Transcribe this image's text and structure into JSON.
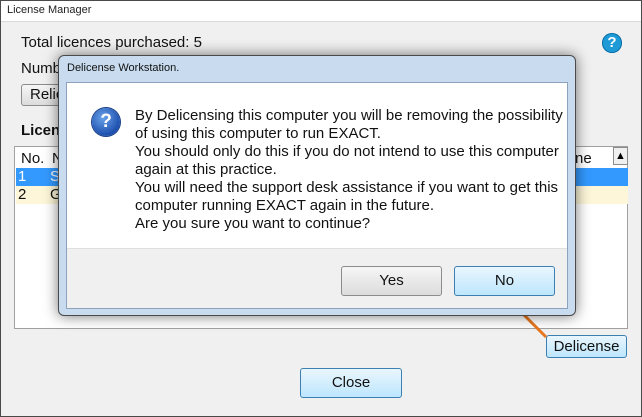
{
  "window": {
    "title": "License Manager"
  },
  "summary": {
    "total_purchased": "Total licences purchased: 5",
    "number_partial": "Numb"
  },
  "reload_button_partial": "Relic",
  "section_label_partial": "Licen",
  "list": {
    "col_no": "No.",
    "col_name_partial": "N",
    "col_right_partial": "ne",
    "rows": [
      {
        "no": "1",
        "name_partial": "S"
      },
      {
        "no": "2",
        "name_partial": "G"
      }
    ]
  },
  "delicense_button": "Delicense",
  "close_button": "Close",
  "dialog": {
    "title": "Delicense Workstation.",
    "message_lines": [
      "By Delicensing this computer you will be removing the possibility",
      "of using this computer to run EXACT.",
      "You should only do this if you do not intend to use this computer",
      "again at this practice.",
      "You will need the support desk assistance if you want to get this",
      "computer running EXACT again in the future.",
      "Are you sure you want to continue?"
    ],
    "yes_button": "Yes",
    "no_button": "No"
  },
  "icons": {
    "help": "help-icon",
    "question": "question-icon",
    "annotation": "arrow-icon"
  },
  "colors": {
    "selected_row": "#3399ff",
    "alt_row": "#fdf6d8",
    "annotation_arrow": "#e8761d"
  }
}
